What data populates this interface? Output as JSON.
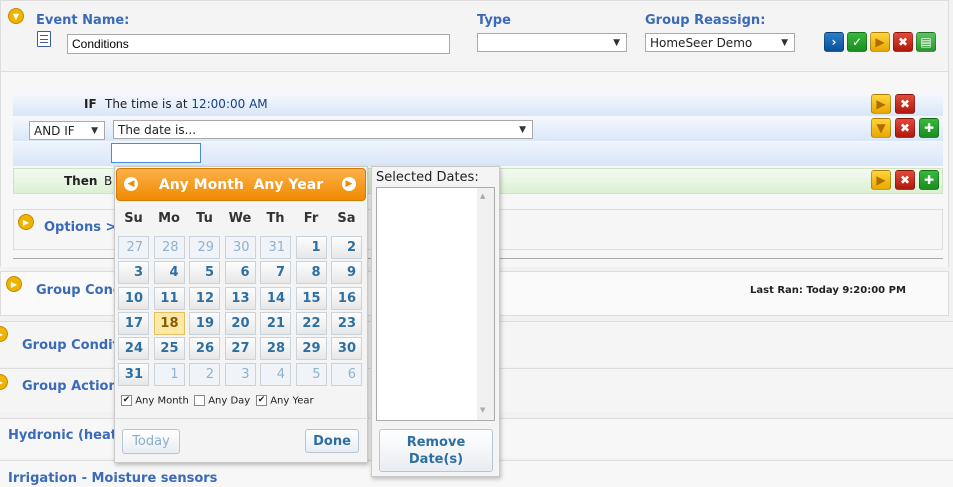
{
  "event": {
    "name_label": "Event Name:",
    "name_value": "Conditions",
    "type_label": "Type",
    "type_value": "",
    "group_label": "Group Reassign:",
    "group_value": "HomeSeer Demo"
  },
  "if_row": {
    "keyword": "IF",
    "text": "The time is at",
    "time": "12:00:00 AM"
  },
  "andif_row": {
    "select": "AND IF",
    "condition": "The date is..."
  },
  "then_row": {
    "keyword": "Then",
    "text_start": "B"
  },
  "options_label": "Options >",
  "group_conditions_1": "Group Cond",
  "last_ran": "Last Ran: Today 9:20:00 PM",
  "group_conditions_2": "Group Condit",
  "group_actions": "Group Actions",
  "hydronic": "Hydronic (heati",
  "irrigation": "Irrigation - Moisture sensors",
  "calendar": {
    "header": "Any Month  Any Year",
    "prev_icon": "chevron-left-icon",
    "next_icon": "chevron-right-icon",
    "weekdays": [
      "Su",
      "Mo",
      "Tu",
      "We",
      "Th",
      "Fr",
      "Sa"
    ],
    "weeks": [
      [
        "27",
        "28",
        "29",
        "30",
        "31",
        "1",
        "2"
      ],
      [
        "3",
        "4",
        "5",
        "6",
        "7",
        "8",
        "9"
      ],
      [
        "10",
        "11",
        "12",
        "13",
        "14",
        "15",
        "16"
      ],
      [
        "17",
        "18",
        "19",
        "20",
        "21",
        "22",
        "23"
      ],
      [
        "24",
        "25",
        "26",
        "27",
        "28",
        "29",
        "30"
      ],
      [
        "31",
        "1",
        "2",
        "3",
        "4",
        "5",
        "6"
      ]
    ],
    "today": "18",
    "any_month": "Any Month",
    "any_day": "Any Day",
    "any_year": "Any Year",
    "any_month_checked": true,
    "any_day_checked": false,
    "any_year_checked": true,
    "today_btn": "Today",
    "done_btn": "Done"
  },
  "selected": {
    "label": "Selected Dates:",
    "remove_btn": "Remove Date(s)"
  }
}
